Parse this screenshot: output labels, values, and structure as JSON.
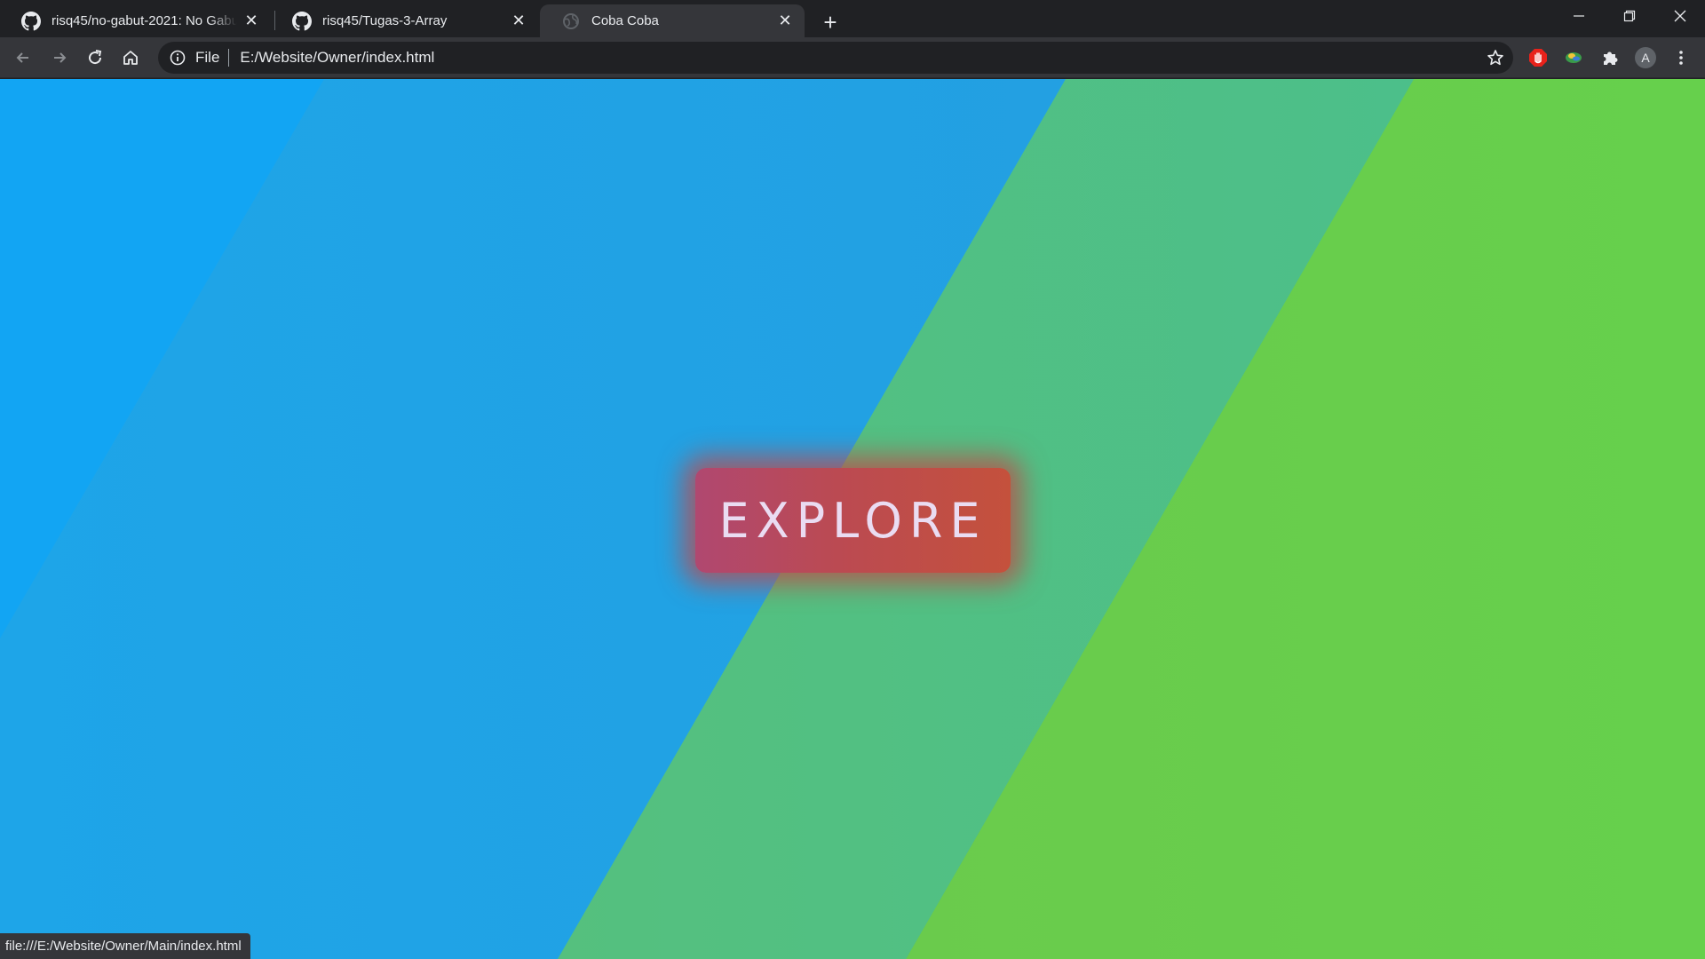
{
  "tabs": [
    {
      "title": "risq45/no-gabut-2021: No Gabut",
      "icon": "github-icon",
      "active": false
    },
    {
      "title": "risq45/Tugas-3-Array",
      "icon": "github-icon",
      "active": false
    },
    {
      "title": "Coba Coba",
      "icon": "globe-icon",
      "active": true
    }
  ],
  "omnibox": {
    "scheme_chip": "File",
    "url": "E:/Website/Owner/index.html"
  },
  "profile_initial": "A",
  "page": {
    "explore_label": "EXPLORE"
  },
  "status_url": "file:///E:/Website/Owner/Main/index.html",
  "colors": {
    "blue": "#1aa6ee",
    "teal": "#52bf86",
    "green": "#6acd4a",
    "button": "#bb4a55",
    "button_text": "#eadcf2",
    "chrome_dark": "#202124",
    "chrome_toolbar": "#35363a"
  }
}
